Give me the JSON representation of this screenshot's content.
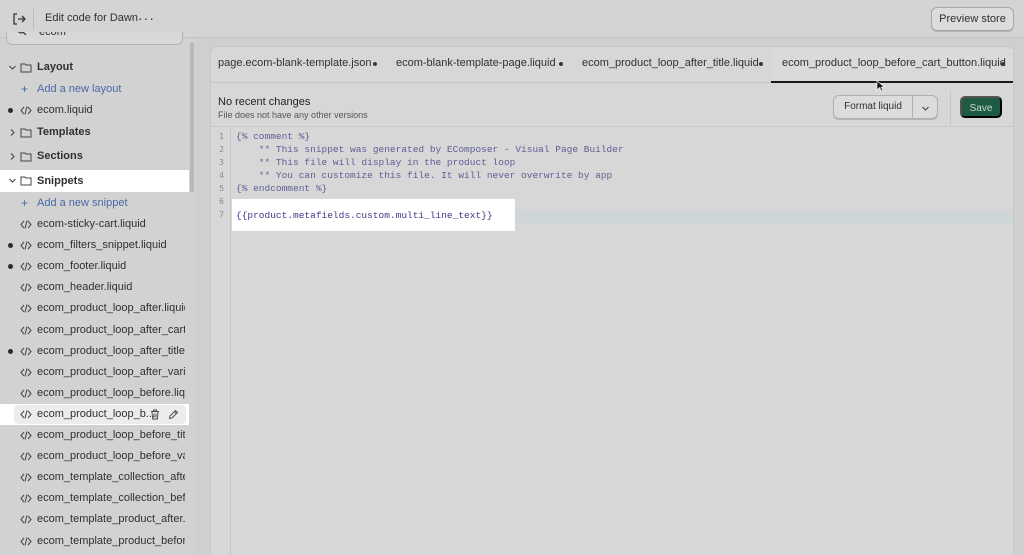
{
  "topbar": {
    "title": "Edit code for Dawn",
    "more": "···",
    "preview_label": "Preview store"
  },
  "sidebar": {
    "search_value": "ecom",
    "folders": {
      "layout": "Layout",
      "layout_add": "Add a new layout",
      "ecom_liquid": "ecom.liquid",
      "templates": "Templates",
      "sections": "Sections",
      "snippets": "Snippets",
      "snippets_add": "Add a new snippet"
    },
    "files": [
      {
        "label": "ecom-sticky-cart.liquid",
        "modified": false
      },
      {
        "label": "ecom_filters_snippet.liquid",
        "modified": true
      },
      {
        "label": "ecom_footer.liquid",
        "modified": true
      },
      {
        "label": "ecom_header.liquid",
        "modified": false
      },
      {
        "label": "ecom_product_loop_after.liquid",
        "modified": false
      },
      {
        "label": "ecom_product_loop_after_cart_...",
        "modified": false
      },
      {
        "label": "ecom_product_loop_after_title.l...",
        "modified": true
      },
      {
        "label": "ecom_product_loop_after_varia...",
        "modified": false
      },
      {
        "label": "ecom_product_loop_before.liquid",
        "modified": false
      },
      {
        "label": "ecom_product_loop_b...",
        "modified": false,
        "selected": true
      },
      {
        "label": "ecom_product_loop_before_titl...",
        "modified": false
      },
      {
        "label": "ecom_product_loop_before_var...",
        "modified": false
      },
      {
        "label": "ecom_template_collection_after...",
        "modified": false
      },
      {
        "label": "ecom_template_collection_befo...",
        "modified": false
      },
      {
        "label": "ecom_template_product_after.li...",
        "modified": false
      },
      {
        "label": "ecom_template_product_before...",
        "modified": false
      }
    ]
  },
  "tabs": [
    {
      "label": "page.ecom-blank-template.json"
    },
    {
      "label": "ecom-blank-template-page.liquid"
    },
    {
      "label": "ecom_product_loop_after_title.liquid"
    },
    {
      "label": "ecom_product_loop_before_cart_button.liquid",
      "active": true
    }
  ],
  "toolbar": {
    "status_title": "No recent changes",
    "status_sub": "File does not have any other versions",
    "format_label": "Format liquid",
    "save_label": "Save"
  },
  "editor": {
    "line_numbers": [
      "1",
      "2",
      "3",
      "4",
      "5",
      "6",
      "7"
    ],
    "lines": [
      "{% comment %}",
      "    ** This snippet was generated by EComposer - Visual Page Builder",
      "    ** This file will display in the product loop",
      "    ** You can customize this file. It will never overwrite by app",
      "{% endcomment %}",
      "",
      "{{product.metafields.custom.multi_line_text}}"
    ]
  },
  "colors": {
    "save_button": "#1f5b43",
    "link": "#4a6aa8",
    "highlight": "#ffffff"
  }
}
